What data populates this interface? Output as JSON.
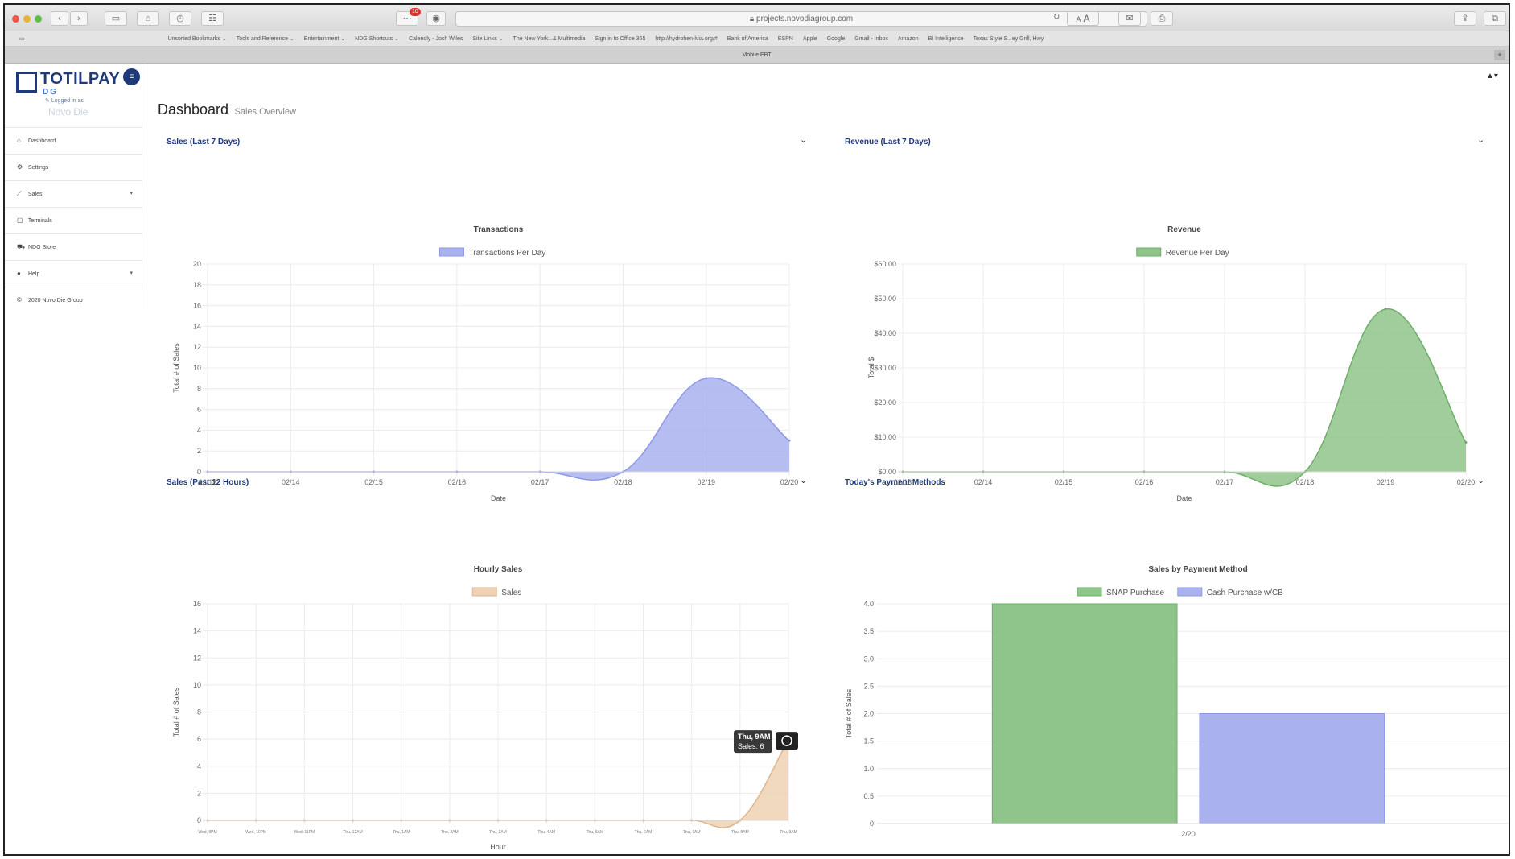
{
  "browser": {
    "url": "projects.novodiagroup.com",
    "tab_title": "Mobile EBT",
    "notification_count": "10",
    "reader_small": "A",
    "reader_large": "A",
    "bookmarks": [
      "Unsorted Bookmarks ⌄",
      "Tools and Reference ⌄",
      "Entertainment ⌄",
      "NDG Shortcuts ⌄",
      "Calendly - Josh Wiles",
      "Site Links ⌄",
      "The New York...& Multimedia",
      "Sign in to Office 365",
      "http://hydrohen-lvia.org/#",
      "Bank of America",
      "ESPN",
      "Apple",
      "Google",
      "Gmail - Inbox",
      "Amazon",
      "BI Intelligence",
      "Texas Style S...ey Grill, Hwy"
    ]
  },
  "sidebar": {
    "brand": "TOTILPAY",
    "brand_sub": "DG",
    "logged_in_label": "Logged in as",
    "user_name": "Novo Die",
    "items": [
      {
        "label": "Dashboard",
        "icon": "home-icon",
        "glyph": "⌂"
      },
      {
        "label": "Settings",
        "icon": "gears-icon",
        "glyph": "⚙"
      },
      {
        "label": "Sales",
        "icon": "line-chart-icon",
        "glyph": "⟋",
        "caret": "▾"
      },
      {
        "label": "Terminals",
        "icon": "tablet-icon",
        "glyph": "▢"
      },
      {
        "label": "NDG Store",
        "icon": "cart-icon",
        "glyph": "⛟"
      },
      {
        "label": "Help",
        "icon": "question-icon",
        "glyph": "●",
        "caret": "▾"
      },
      {
        "label": "2020 Novo Die Group",
        "icon": "copyright-icon",
        "glyph": "©"
      }
    ]
  },
  "header": {
    "title": "Dashboard",
    "subtitle": "Sales Overview",
    "user_icon": "▲▾"
  },
  "panels": {
    "sales7": {
      "heading": "Sales (Last 7 Days)",
      "toggle": "⌄"
    },
    "revenue7": {
      "heading": "Revenue (Last 7 Days)",
      "toggle": "⌄"
    },
    "sales12": {
      "heading": "Sales (Past 12 Hours)",
      "toggle": "⌄"
    },
    "payments": {
      "heading": "Today's Payment Methods",
      "toggle": "⌄"
    }
  },
  "colors": {
    "blue_fill": "#a9b2ee",
    "blue_line": "#8e99e6",
    "green_fill": "#8fc48a",
    "green_line": "#6fae6a",
    "tan_fill": "#efd2b5",
    "tan_line": "#e0b48c",
    "brand": "#1f3a7a"
  },
  "chart_data": [
    {
      "type": "area",
      "title": "Transactions",
      "legend": [
        "Transactions Per Day"
      ],
      "xlabel": "Date",
      "ylabel": "Total # of Sales",
      "categories": [
        "02/13",
        "02/14",
        "02/15",
        "02/16",
        "02/17",
        "02/18",
        "02/19",
        "02/20"
      ],
      "values": [
        0,
        0,
        0,
        0,
        0,
        0,
        9,
        3
      ],
      "ylim": [
        0,
        20
      ],
      "yticks": [
        "0",
        "2",
        "4",
        "6",
        "8",
        "10",
        "12",
        "14",
        "16",
        "18",
        "20"
      ],
      "grid": true,
      "legend_position": "top"
    },
    {
      "type": "area",
      "title": "Revenue",
      "legend": [
        "Revenue Per Day"
      ],
      "xlabel": "Date",
      "ylabel": "Total $",
      "categories": [
        "02/13",
        "02/14",
        "02/15",
        "02/16",
        "02/17",
        "02/18",
        "02/19",
        "02/20"
      ],
      "values": [
        0,
        0,
        0,
        0,
        0,
        0,
        47,
        8.5
      ],
      "ylim": [
        0,
        60
      ],
      "yticks": [
        "$0.00",
        "$10.00",
        "$20.00",
        "$30.00",
        "$40.00",
        "$50.00",
        "$60.00"
      ],
      "grid": true,
      "legend_position": "top"
    },
    {
      "type": "area",
      "title": "Hourly Sales",
      "legend": [
        "Sales"
      ],
      "xlabel": "Hour",
      "ylabel": "Total # of Sales",
      "categories": [
        "Wed, 8PM",
        "Wed, 10PM",
        "Wed, 11PM",
        "Thu, 12AM",
        "Thu, 1AM",
        "Thu, 2AM",
        "Thu, 3AM",
        "Thu, 4AM",
        "Thu, 5AM",
        "Thu, 6AM",
        "Thu, 7AM",
        "Thu, 8AM",
        "Thu, 9AM"
      ],
      "values": [
        0,
        0,
        0,
        0,
        0,
        0,
        0,
        0,
        0,
        0,
        0,
        0,
        6
      ],
      "ylim": [
        0,
        16
      ],
      "yticks": [
        "0",
        "2",
        "4",
        "6",
        "8",
        "10",
        "12",
        "14",
        "16"
      ],
      "grid": true,
      "legend_position": "top",
      "tooltip": {
        "title": "Thu, 9AM",
        "body": "Sales: 6"
      }
    },
    {
      "type": "bar",
      "title": "Sales by Payment Method",
      "categories": [
        "2/20"
      ],
      "series": [
        {
          "name": "SNAP Purchase",
          "values": [
            4
          ]
        },
        {
          "name": "Cash Purchase w/CB",
          "values": [
            2
          ]
        }
      ],
      "ylabel": "Total # of Sales",
      "ylim": [
        0,
        4
      ],
      "yticks": [
        "0",
        "0.5",
        "1.0",
        "1.5",
        "2.0",
        "2.5",
        "3.0",
        "3.5",
        "4.0"
      ],
      "grid": true,
      "legend_position": "top"
    }
  ]
}
